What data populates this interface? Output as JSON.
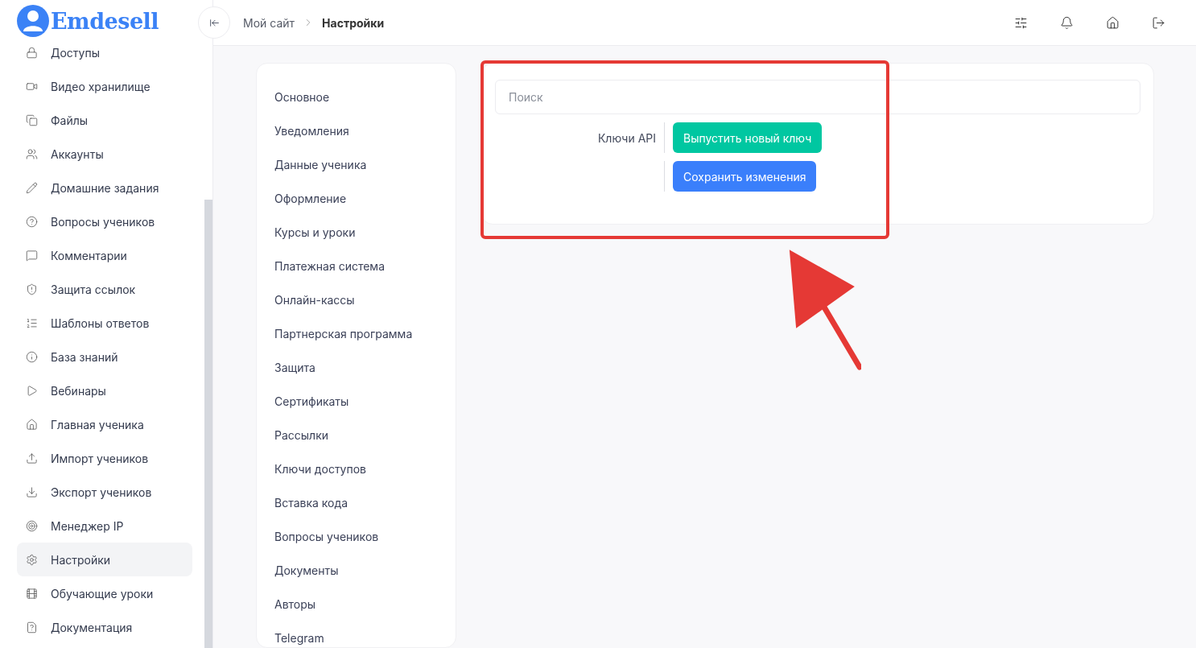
{
  "logo": {
    "text": "Emdesell"
  },
  "sidebar": {
    "items": [
      {
        "label": "Доступы",
        "selected": false
      },
      {
        "label": "Видео хранилище",
        "selected": false
      },
      {
        "label": "Файлы",
        "selected": false
      },
      {
        "label": "Аккаунты",
        "selected": false
      },
      {
        "label": "Домашние задания",
        "selected": false
      },
      {
        "label": "Вопросы учеников",
        "selected": false
      },
      {
        "label": "Комментарии",
        "selected": false
      },
      {
        "label": "Защита ссылок",
        "selected": false
      },
      {
        "label": "Шаблоны ответов",
        "selected": false
      },
      {
        "label": "База знаний",
        "selected": false
      },
      {
        "label": "Вебинары",
        "selected": false
      },
      {
        "label": "Главная ученика",
        "selected": false
      },
      {
        "label": "Импорт учеников",
        "selected": false
      },
      {
        "label": "Экспорт учеников",
        "selected": false
      },
      {
        "label": "Менеджер IP",
        "selected": false
      },
      {
        "label": "Настройки",
        "selected": true
      },
      {
        "label": "Обучающие уроки",
        "selected": false
      },
      {
        "label": "Документация",
        "selected": false
      }
    ]
  },
  "breadcrumb": [
    "Мой сайт",
    "Настройки"
  ],
  "settings_nav": {
    "items": [
      {
        "label": "Основное"
      },
      {
        "label": "Уведомления"
      },
      {
        "label": "Данные ученика"
      },
      {
        "label": "Оформление"
      },
      {
        "label": "Курсы и уроки"
      },
      {
        "label": "Платежная система"
      },
      {
        "label": "Онлайн-кассы"
      },
      {
        "label": "Партнерская программа"
      },
      {
        "label": "Защита"
      },
      {
        "label": "Сертификаты"
      },
      {
        "label": "Рассылки"
      },
      {
        "label": "Ключи доступов"
      },
      {
        "label": "Вставка кода"
      },
      {
        "label": "Вопросы учеников"
      },
      {
        "label": "Документы"
      },
      {
        "label": "Авторы"
      },
      {
        "label": "Telegram"
      }
    ]
  },
  "search": {
    "placeholder": "Поиск"
  },
  "form_rows": [
    {
      "label": "Ключи API",
      "button": "Выпустить новый ключ",
      "kind": "issue"
    },
    {
      "label": "",
      "button": "Сохранить изменения",
      "kind": "save"
    }
  ]
}
